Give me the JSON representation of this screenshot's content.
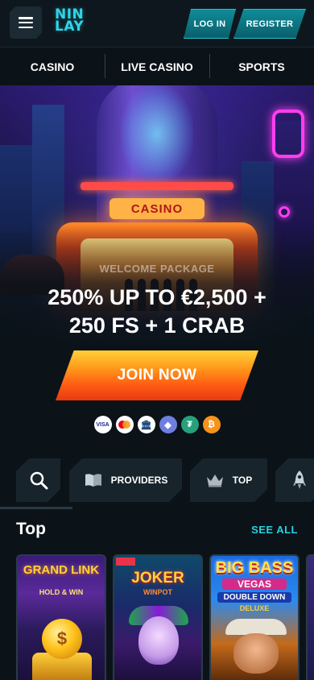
{
  "header": {
    "logo_line1": "NIN",
    "logo_line2": "LAY",
    "login_label": "LOG IN",
    "register_label": "REGISTER"
  },
  "nav": {
    "items": [
      {
        "label": "CASINO"
      },
      {
        "label": "LIVE CASINO"
      },
      {
        "label": "SPORTS"
      }
    ]
  },
  "hero": {
    "sign_text": "CASINO",
    "kicker": "WELCOME PACKAGE",
    "headline_line1": "250% UP TO €2,500 +",
    "headline_line2": "250 FS + 1 CRAB",
    "cta_label": "JOIN NOW",
    "payment_methods": [
      {
        "name": "visa",
        "label": "VISA"
      },
      {
        "name": "mastercard",
        "label": ""
      },
      {
        "name": "bank-transfer",
        "label": "🏛"
      },
      {
        "name": "ethereum",
        "label": "◆"
      },
      {
        "name": "tether",
        "label": "₮"
      },
      {
        "name": "bitcoin",
        "label": "₿"
      }
    ]
  },
  "categories": {
    "search_icon": "search-icon",
    "providers_label": "PROVIDERS",
    "top_label": "TOP"
  },
  "top_section": {
    "title": "Top",
    "see_all": "SEE ALL",
    "games": [
      {
        "title": "GRAND LINK",
        "subtitle": "HOLD & WIN"
      },
      {
        "title": "JOKER",
        "subtitle": "WINPOT"
      },
      {
        "title": "BIG BASS",
        "subtitle1": "VEGAS",
        "subtitle2": "DOUBLE DOWN",
        "subtitle3": "DELUXE"
      }
    ]
  },
  "colors": {
    "accent": "#25d3df",
    "cta_orange": "#ff5a14",
    "background": "#0b1319"
  }
}
